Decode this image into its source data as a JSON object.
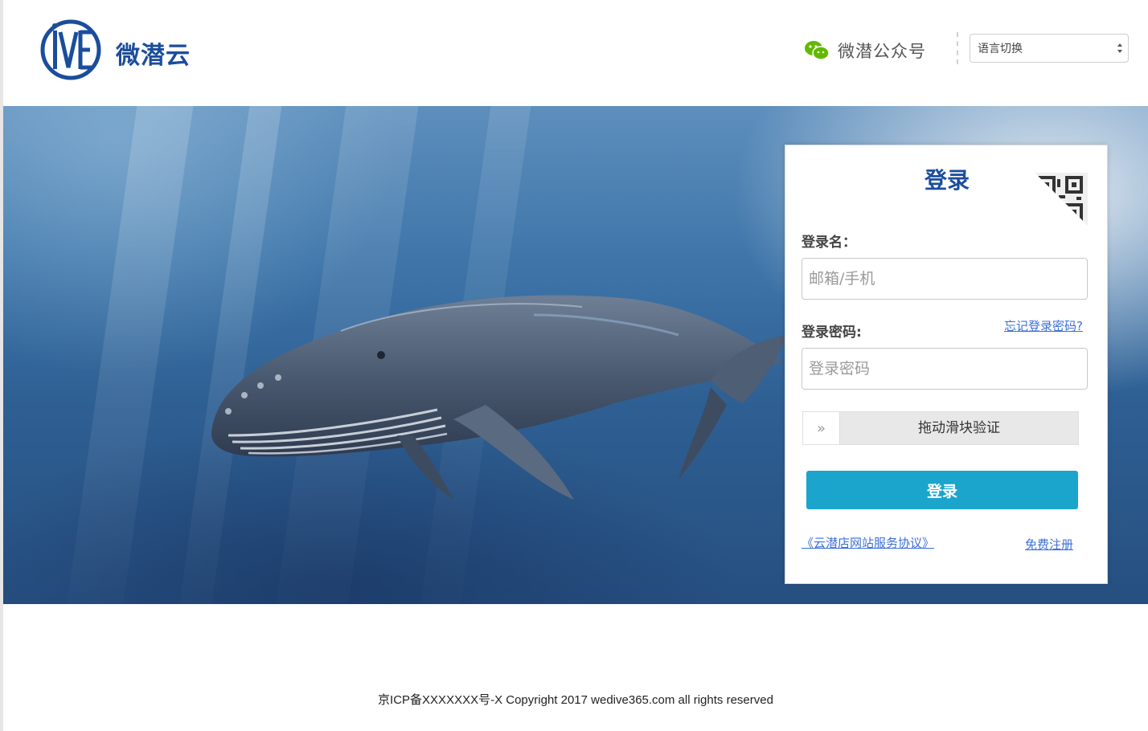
{
  "header": {
    "brand_name": "微潜云",
    "logo_icon": "wedive-logo-icon",
    "wechat_label": "微潜公众号",
    "wechat_icon": "wechat-icon",
    "language_select_value": "语言切换"
  },
  "hero": {
    "background_icon": "humpback-whale-illustration"
  },
  "login": {
    "title": "登录",
    "qr_icon": "qr-code-icon",
    "username_label": "登录名：",
    "username_placeholder": "邮箱/手机",
    "password_label": "登录密码:",
    "password_placeholder": "登录密码",
    "forgot_password": "忘记登录密码?",
    "slider_handle_glyph": "»",
    "slider_text": "拖动滑块验证",
    "submit_label": "登录",
    "agreement_link": "《云潜店网站服务协议》",
    "register_link": "免费注册"
  },
  "footer": {
    "copyright": "京ICP备XXXXXXX号-X Copyright 2017 wedive365.com all rights reserved"
  },
  "colors": {
    "brand_blue": "#1b4d9c",
    "button_teal": "#1ba5cc",
    "link_blue": "#3a6fd8",
    "wechat_green": "#62b900"
  }
}
